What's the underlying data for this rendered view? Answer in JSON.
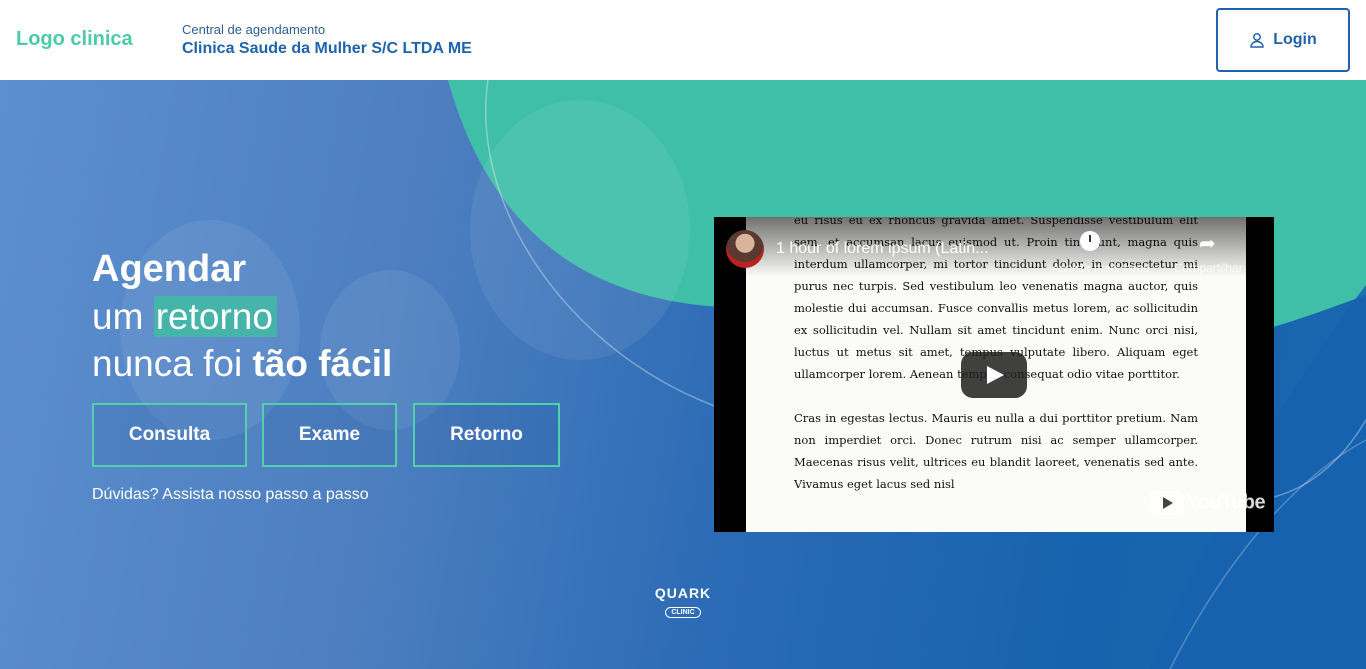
{
  "header": {
    "logo": "Logo clinica",
    "subtitle": "Central de agendamento",
    "clinic_name": "Clinica Saude da Mulher S/C LTDA ME",
    "login_label": "Login"
  },
  "hero": {
    "line1": "Agendar",
    "line2_pre": "um",
    "line2_highlight": "retorno",
    "line3_pre": "nunca foi",
    "line3_bold": "tão fácil",
    "buttons": [
      "Consulta",
      "Exame",
      "Retorno"
    ],
    "help_text": "Dúvidas? Assista nosso passo a passo"
  },
  "video": {
    "title": "1 hour of lorem ipsum (Latin...",
    "watch_later": "Assistir mais tarde",
    "share": "Compartilhar",
    "brand": "YouTube",
    "paragraph1": "eu risus eu ex rhoncus gravida amet. Suspendisse vestibulum elit sem, et accumsan lacus euismod ut. Proin tincidunt, magna quis interdum ullamcorper, mi tortor tincidunt dolor, in consectetur mi purus nec turpis. Sed vestibulum leo venenatis magna auctor, quis molestie dui accumsan. Fusce convallis metus lorem, ac sollicitudin ex sollicitudin vel. Nullam sit amet tincidunt enim. Nunc orci nisi, luctus ut metus sit amet, tempus vulputate libero. Aliquam eget ullamcorper lorem. Aenean tempus consequat odio vitae porttitor.",
    "paragraph2": "Cras in egestas lectus. Mauris eu nulla a dui porttitor pretium. Nam non imperdiet orci. Donec rutrum nisi ac semper ullamcorper. Maecenas risus velit, ultrices eu blandit laoreet, venenatis sed ante. Vivamus eget lacus sed nisl"
  },
  "footer_logo": {
    "main": "QUARK",
    "sub": "CLINIC"
  },
  "colors": {
    "accent_green": "#4ecba6",
    "brand_blue": "#1f63ad",
    "teal_shape": "#3fbfa8"
  }
}
